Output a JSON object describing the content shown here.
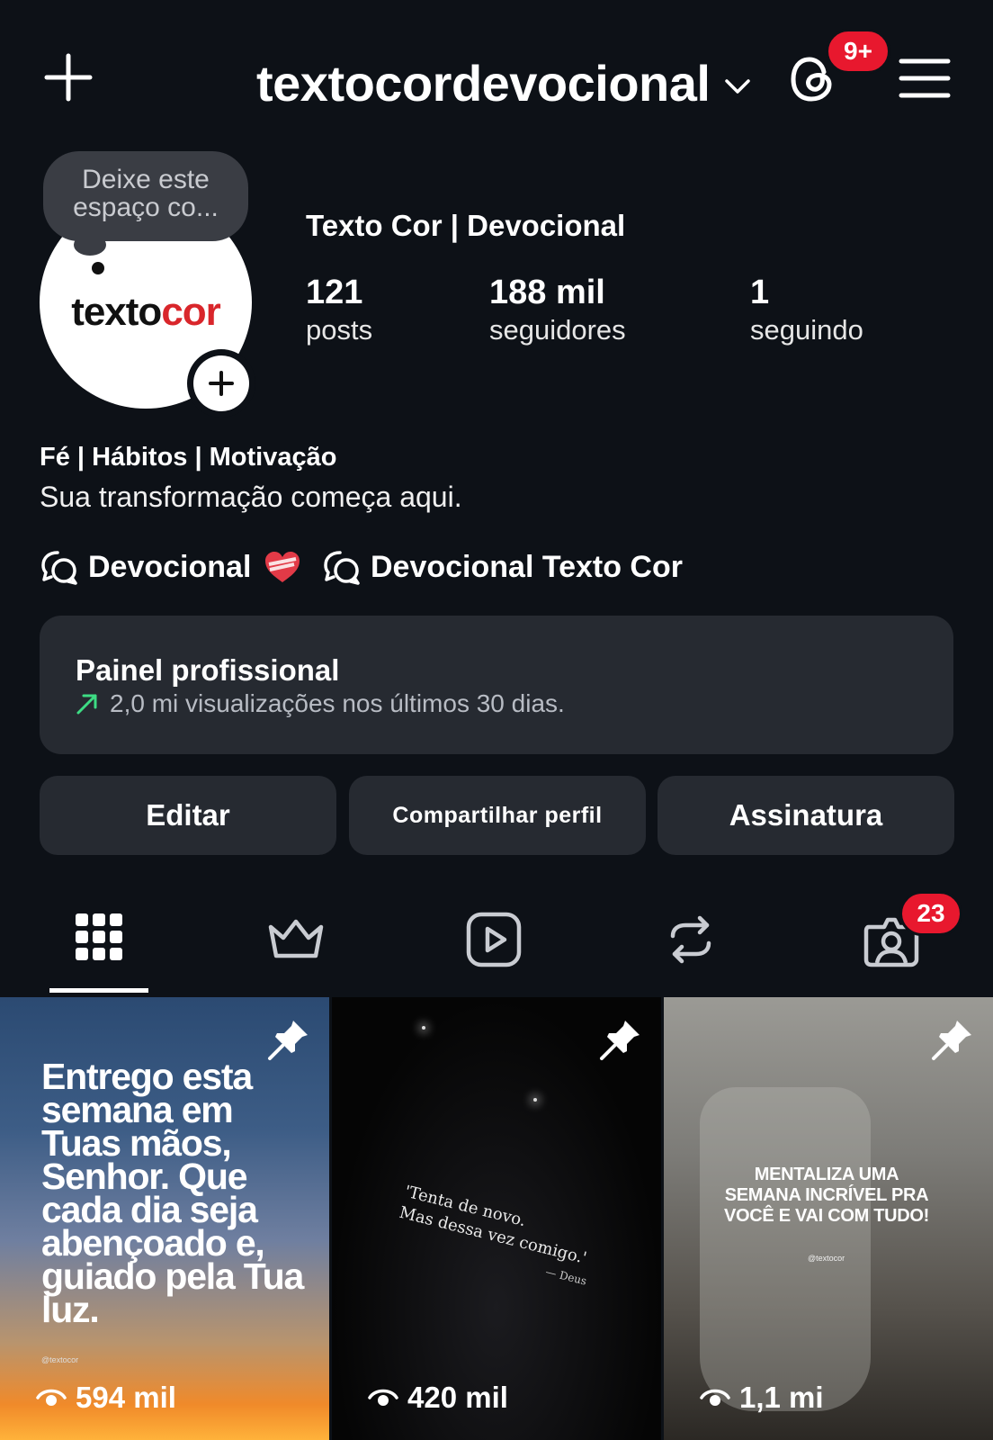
{
  "header": {
    "username": "textocordevocional",
    "notification_badge": "9+",
    "icons": [
      "plus-icon",
      "chevron-down-icon",
      "threads-icon",
      "hamburger-menu-icon"
    ]
  },
  "profile": {
    "note": "Deixe este espaço co...",
    "avatar_logo": {
      "prefix": "texto",
      "suffix": "cor"
    },
    "display_name": "Texto Cor | Devocional",
    "stats": [
      {
        "value": "121",
        "label": "posts"
      },
      {
        "value": "188 mil",
        "label": "seguidores"
      },
      {
        "value": "1",
        "label": "seguindo"
      }
    ],
    "bio_title": "Fé | Hábitos | Motivação",
    "bio_text": "Sua transformação começa aqui.",
    "links": [
      {
        "label": "Devocional"
      },
      {
        "label": "Devocional Texto Cor"
      }
    ]
  },
  "panel": {
    "title": "Painel profissional",
    "subtitle": "2,0 mi visualizações nos últimos 30 dias."
  },
  "actions": {
    "edit": "Editar",
    "share": "Compartilhar perfil",
    "subscription": "Assinatura"
  },
  "tabs": {
    "items": [
      "grid-icon",
      "crown-icon",
      "reels-icon",
      "repost-icon",
      "tagged-icon"
    ],
    "tagged_badge": "23",
    "active": "grid"
  },
  "posts": [
    {
      "text": "Entrego esta semana em Tuas mãos, Senhor. Que cada dia seja abençoado e, guiado pela Tua luz.",
      "credit": "@textocor",
      "views": "594 mil",
      "pinned": true
    },
    {
      "text_line1": "'Tenta de novo.",
      "text_line2": "Mas dessa vez comigo.'",
      "signature": "— Deus",
      "views": "420 mil",
      "pinned": true
    },
    {
      "text": "MENTALIZA UMA SEMANA INCRÍVEL PRA VOCÊ E VAI COM TUDO!",
      "credit": "@textocor",
      "views": "1,1 mi",
      "pinned": true
    }
  ],
  "colors": {
    "background": "#0d1117",
    "card": "#262a31",
    "badge": "#e8182e",
    "trend_arrow": "#3ddc84"
  }
}
